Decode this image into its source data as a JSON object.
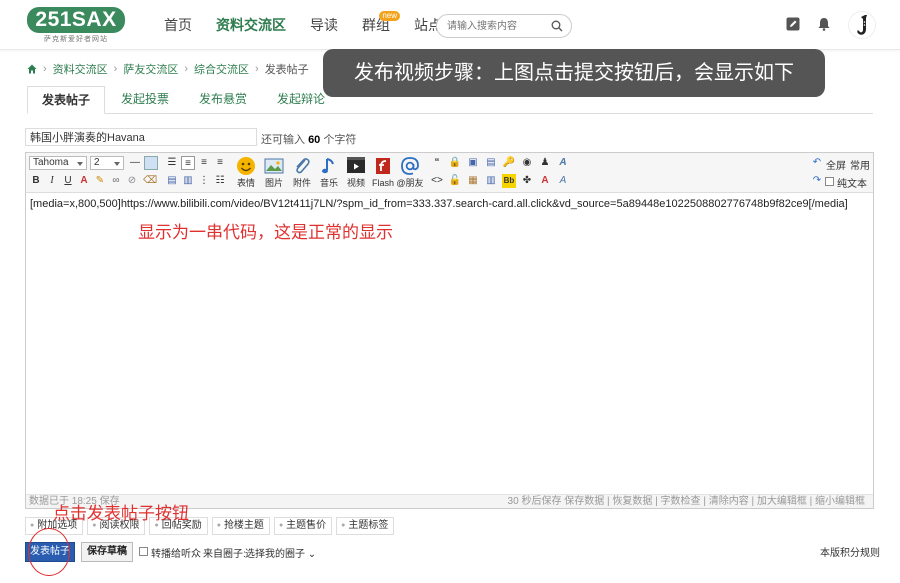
{
  "header": {
    "logo_text": "251SAX",
    "logo_sub": "萨克斯爱好者网站",
    "nav": [
      "首页",
      "资料交流区",
      "导读",
      "群组",
      "站点帮助"
    ],
    "nav_badge": "new",
    "search_placeholder": "请输入搜索内容"
  },
  "breadcrumb": [
    "资料交流区",
    "萨友交流区",
    "综合交流区",
    "发表帖子"
  ],
  "callout": "发布视频步骤：上图点击提交按钮后，会显示如下",
  "tabs": [
    "发表帖子",
    "发起投票",
    "发布悬赏",
    "发起辩论"
  ],
  "subject": {
    "value": "韩国小胖演奏的Havana",
    "hint_prefix": "还可输入",
    "hint_count": "60",
    "hint_suffix": "个字符"
  },
  "toolbar": {
    "font": "Tahoma",
    "size": "2",
    "big_buttons": [
      "表情",
      "图片",
      "附件",
      "音乐",
      "视频",
      "Flash",
      "@朋友"
    ],
    "fullscreen": "全屏",
    "common": "常用",
    "plain_text": "纯文本"
  },
  "editor": {
    "content": "[media=x,800,500]https://www.bilibili.com/video/BV12t411j7LN/?spm_id_from=333.337.search-card.all.click&vd_source=5a89448e1022508802776748b9f82ce9[/media]",
    "annotation": "显示为一串代码，这是正常的显示",
    "status_left": "数据已于 18:25 保存",
    "status_right": "30 秒后保存 保存数据 | 恢复数据  |  字数检查 | 清除内容  |  加大编辑框 | 缩小编辑框"
  },
  "options": [
    "附加选项",
    "阅读权限",
    "回帖奖励",
    "抢楼主题",
    "主题售价",
    "主题标签"
  ],
  "actions": {
    "annotation": "点击发表帖子按钮",
    "post": "发表帖子",
    "draft": "保存草稿",
    "listen": "转播给听众",
    "from_circle_label": "来自圈子:",
    "from_circle_value": "选择我的圈子",
    "rules": "本版积分规则"
  },
  "colors": {
    "brand": "#3a8a5e",
    "link": "#2e7d4f",
    "post_button": "#2a5db0",
    "annotation": "#e03030"
  }
}
